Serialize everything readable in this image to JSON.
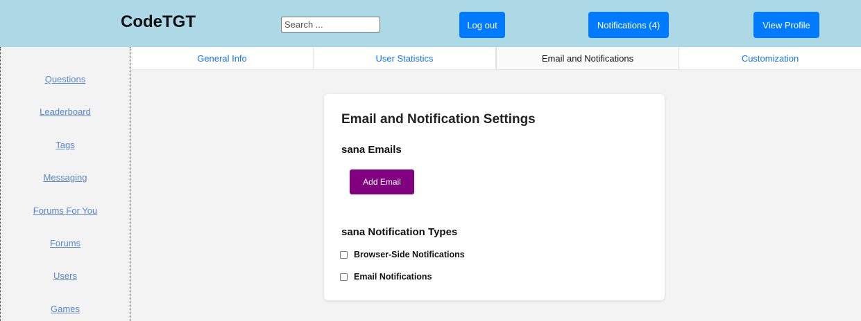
{
  "header": {
    "logo": "CodeTGT",
    "search_placeholder": "Search ...",
    "logout_label": "Log out",
    "notifications_label": "Notifications (4)",
    "view_profile_label": "View Profile",
    "bg_color": "#add8e6",
    "button_color": "#007bff"
  },
  "sidebar": {
    "items": [
      {
        "label": "Questions"
      },
      {
        "label": "Leaderboard"
      },
      {
        "label": "Tags"
      },
      {
        "label": "Messaging"
      },
      {
        "label": "Forums For You"
      },
      {
        "label": "Forums"
      },
      {
        "label": "Users"
      },
      {
        "label": "Games"
      }
    ]
  },
  "tabs": [
    {
      "label": "General Info",
      "active": false
    },
    {
      "label": "User Statistics",
      "active": false
    },
    {
      "label": "Email and Notifications",
      "active": true
    },
    {
      "label": "Customization",
      "active": false
    }
  ],
  "settings": {
    "title": "Email and Notification Settings",
    "emails_heading": "sana Emails",
    "add_email_label": "Add Email",
    "add_email_color": "#800080",
    "notification_types_heading": "sana Notification Types",
    "options": [
      {
        "label": "Browser-Side Notifications",
        "checked": false
      },
      {
        "label": "Email Notifications",
        "checked": false
      }
    ]
  }
}
